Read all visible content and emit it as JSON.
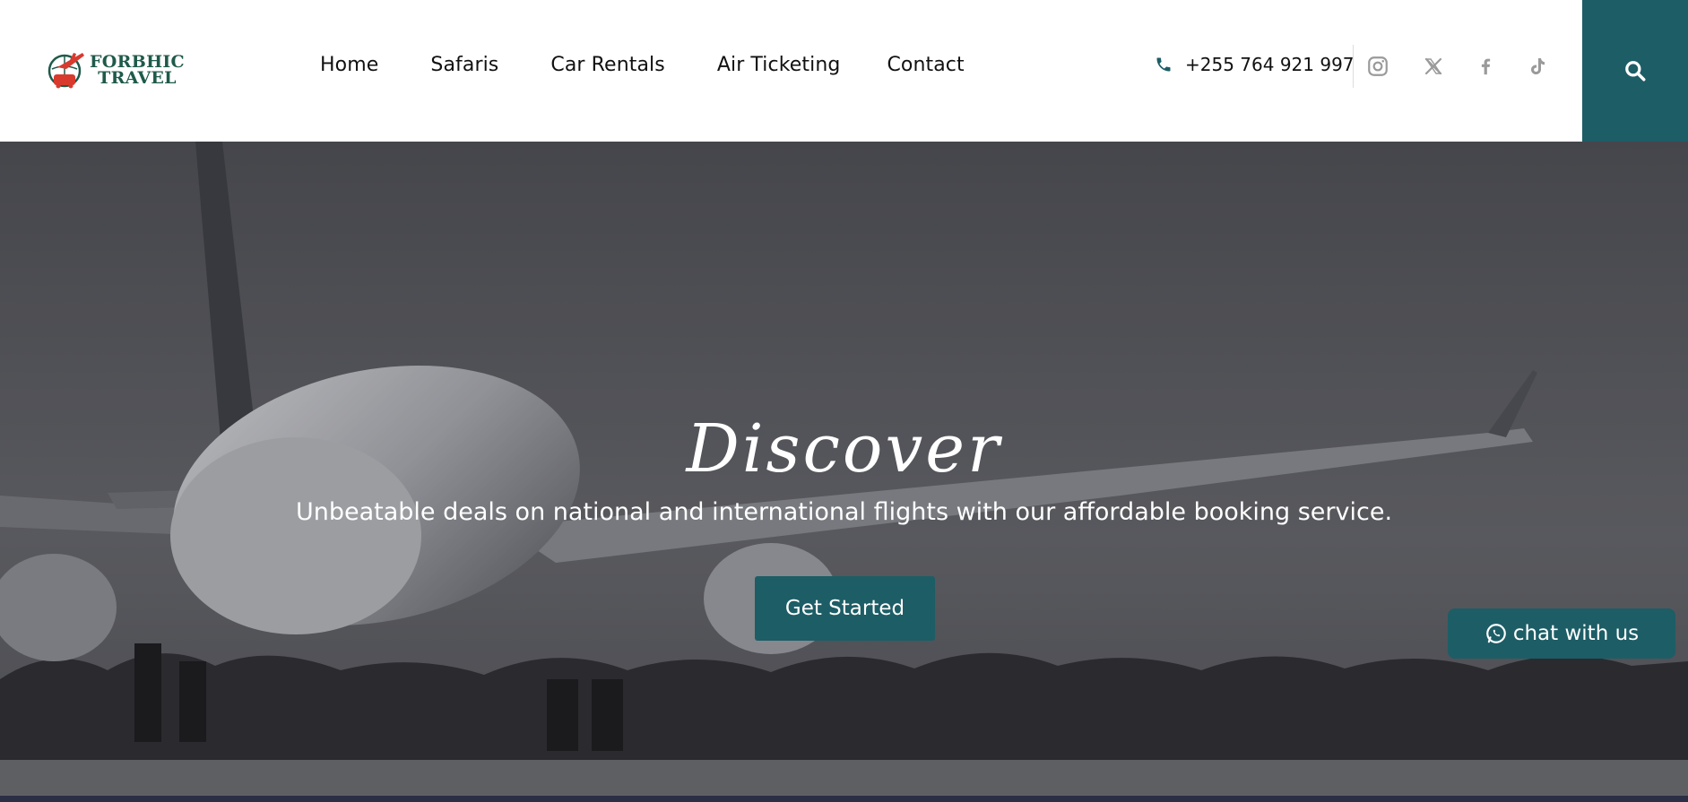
{
  "brand": {
    "line1": "FORBHIC",
    "line2": "TRAVEL",
    "colors": {
      "primary": "#1d5d66",
      "logo_red": "#d83a2e",
      "logo_green": "#1f5a4a"
    }
  },
  "nav": {
    "items": [
      {
        "label": "Home"
      },
      {
        "label": "Safaris"
      },
      {
        "label": "Car Rentals"
      },
      {
        "label": "Air Ticketing"
      },
      {
        "label": "Contact"
      }
    ]
  },
  "contact": {
    "phone_icon": "phone-icon",
    "phone": "+255 764 921 997"
  },
  "social": [
    {
      "icon": "instagram-icon"
    },
    {
      "icon": "x-icon"
    },
    {
      "icon": "facebook-icon"
    },
    {
      "icon": "tiktok-icon"
    }
  ],
  "search": {
    "icon": "search-icon"
  },
  "hero": {
    "title": "Discover",
    "subtitle": "Unbeatable deals on national and international flights with our affordable booking service.",
    "cta_label": "Get Started"
  },
  "chat": {
    "icon": "whatsapp-icon",
    "label": "chat with us"
  }
}
